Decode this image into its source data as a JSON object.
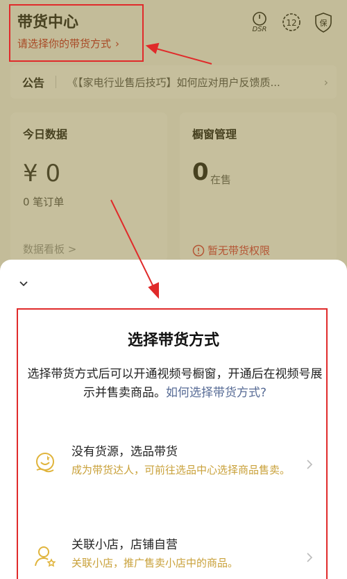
{
  "header": {
    "title": "带货中心",
    "subtitle": "请选择你的带货方式",
    "icons": [
      "dsr-icon",
      "level-12-icon",
      "guarantee-shield-icon"
    ],
    "dsr_text": "DSR",
    "level_text": "12",
    "guarantee_text": "保"
  },
  "notice": {
    "label": "公告",
    "text": "《【家电行业售后技巧】如何应对用户反馈质..."
  },
  "today_card": {
    "title": "今日数据",
    "amount": "¥ 0",
    "orders": "0 笔订单",
    "dashboard_link": "数据看板 >"
  },
  "window_card": {
    "title": "橱窗管理",
    "count": "0",
    "count_label": "在售",
    "no_permission": "暂无带货权限"
  },
  "sheet": {
    "title": "选择带货方式",
    "desc": "选择带货方式后可以开通视频号橱窗，开通后在视频号展示并售卖商品。",
    "desc_link": "如何选择带货方式?",
    "options": [
      {
        "title": "没有货源，选品带货",
        "desc": "成为带货达人，可前往选品中心选择商品售卖。"
      },
      {
        "title": "关联小店，店铺自营",
        "desc": "关联小店，推广售卖小店中的商品。"
      }
    ]
  },
  "colors": {
    "accent": "#c9a13a",
    "annotation_red": "#e02a2a",
    "link": "#576b95"
  }
}
